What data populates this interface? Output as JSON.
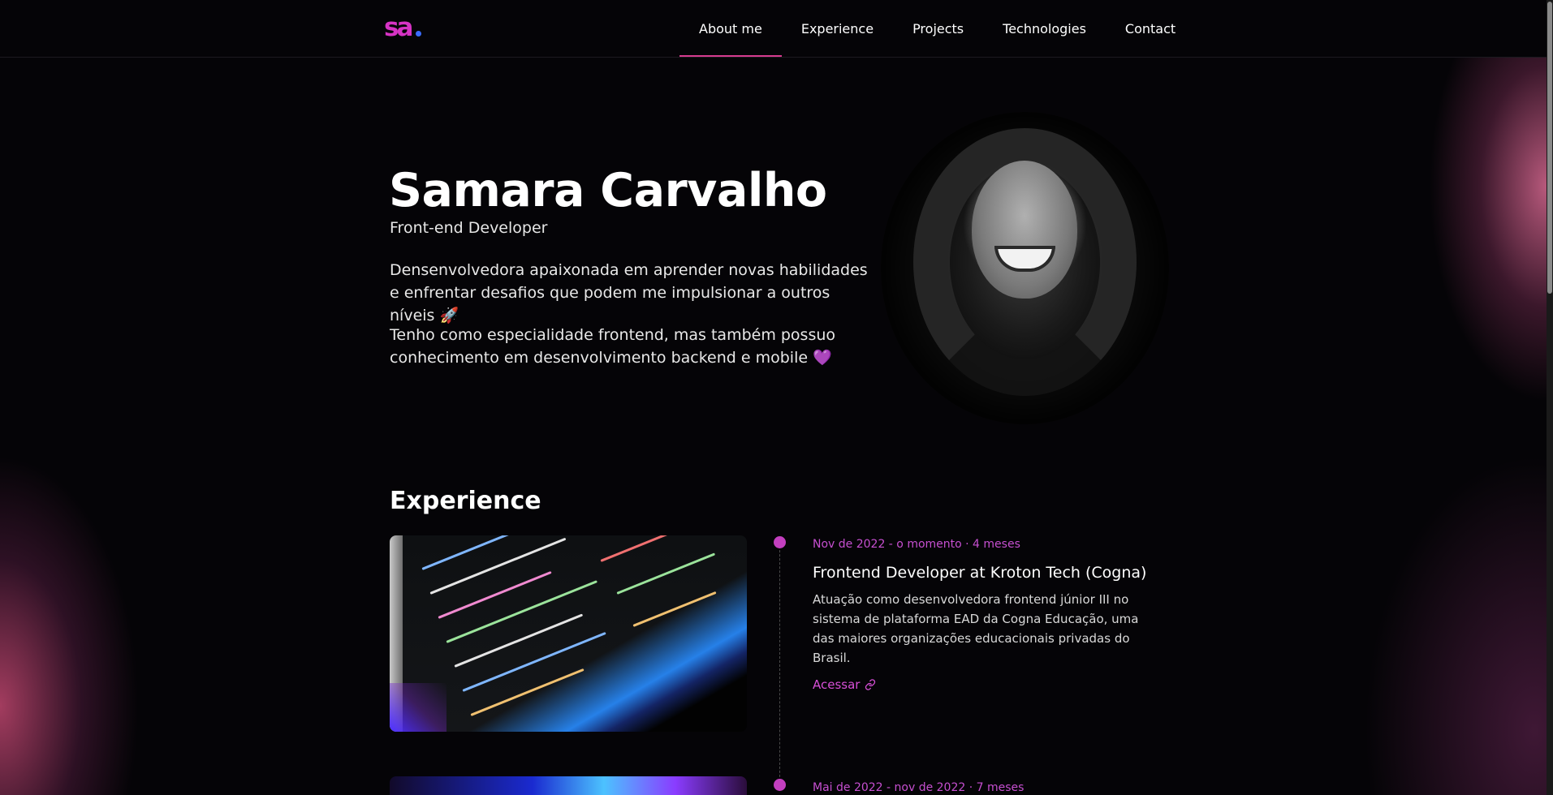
{
  "header": {
    "logo_text": "sa",
    "nav": [
      {
        "label": "About me",
        "active": true
      },
      {
        "label": "Experience",
        "active": false
      },
      {
        "label": "Projects",
        "active": false
      },
      {
        "label": "Technologies",
        "active": false
      },
      {
        "label": "Contact",
        "active": false
      }
    ]
  },
  "hero": {
    "name": "Samara Carvalho",
    "role": "Front-end Developer",
    "paragraph1": "Densenvolvedora apaixonada em aprender novas habilidades e enfrentar desafios que podem me impulsionar a outros níveis 🚀",
    "paragraph2": "Tenho como especialidade frontend, mas também possuo conhecimento em desenvolvimento backend e mobile 💜"
  },
  "experience": {
    "title": "Experience",
    "items": [
      {
        "date": "Nov de 2022 - o momento · 4 meses",
        "title": "Frontend Developer at Kroton Tech (Cogna)",
        "description": "Atuação como desenvolvedora frontend júnior III no sistema de plataforma EAD da Cogna Educação, uma das maiores organizações educacionais privadas do Brasil.",
        "link_label": "Acessar"
      },
      {
        "date": "Mai de 2022 - nov de 2022 · 7 meses"
      }
    ]
  },
  "colors": {
    "accent": "#d633c4",
    "timeline_dot": "#c33fbf",
    "date_text": "#c64fd0",
    "nav_underline": "#d63b8f",
    "background": "#050407"
  },
  "icons": {
    "link": "link-icon",
    "logo": "logo-icon"
  }
}
